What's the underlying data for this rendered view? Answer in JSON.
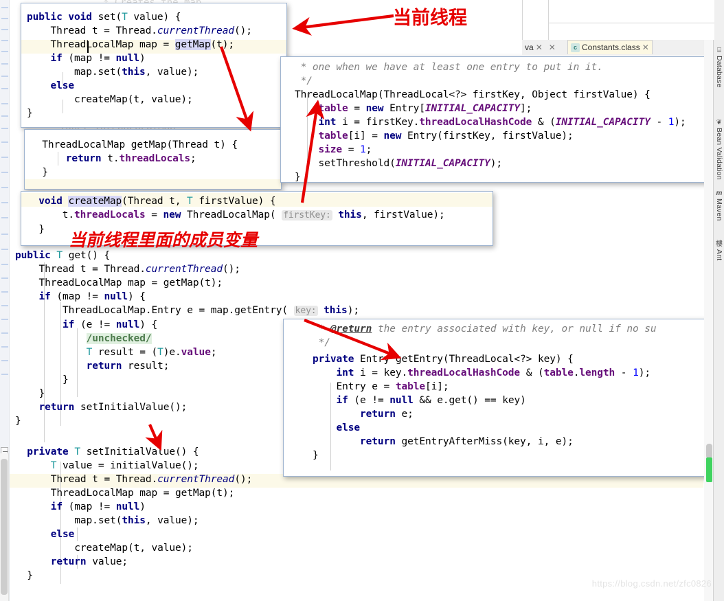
{
  "app": {
    "ide": "IntelliJ IDEA",
    "watermark": "https://blog.csdn.net/zfc0826"
  },
  "tabs": {
    "partial_label": "va",
    "close_glyph": "✕",
    "active": {
      "icon": "class-file-icon",
      "icon_letter": "c",
      "label": "Constants.class"
    }
  },
  "right_sidebar": {
    "items": [
      {
        "label": "Database",
        "icon": "database-icon",
        "glyph": "⌸"
      },
      {
        "label": "Bean Validation",
        "icon": "bean-validation-icon",
        "glyph": "❦"
      },
      {
        "label": "Maven",
        "icon": "maven-icon",
        "glyph": "m"
      },
      {
        "label": "Ant",
        "icon": "ant-icon",
        "glyph": "樓"
      }
    ]
  },
  "annotations": [
    {
      "id": "note-current-thread",
      "text": "当前线程",
      "color": "#e60000"
    },
    {
      "id": "note-member-variable",
      "text": "当前线程里面的成员变量",
      "color": "#e60000"
    }
  ],
  "background_code": {
    "line_top": "* Creates the map",
    "line_mid": "* Inner ThreadLocalMap"
  },
  "editor": {
    "name": "ThreadLocal.java",
    "lines": [
      {
        "indent": 0,
        "text": "public T get() {"
      },
      {
        "indent": 1,
        "text": "Thread t = Thread.currentThread();"
      },
      {
        "indent": 1,
        "text": "ThreadLocalMap map = getMap(t);"
      },
      {
        "indent": 1,
        "text": "if (map != null) {"
      },
      {
        "indent": 2,
        "text": "ThreadLocalMap.Entry e = map.getEntry( key: this);"
      },
      {
        "indent": 2,
        "text": "if (e != null) {"
      },
      {
        "indent": 3,
        "text": "/unchecked/"
      },
      {
        "indent": 3,
        "text": "T result = (T)e.value;"
      },
      {
        "indent": 3,
        "text": "return result;"
      },
      {
        "indent": 2,
        "text": "}"
      },
      {
        "indent": 1,
        "text": "}"
      },
      {
        "indent": 1,
        "text": "return setInitialValue();"
      },
      {
        "indent": 0,
        "text": "}"
      },
      {
        "indent": 0,
        "text": "private T setInitialValue() {"
      },
      {
        "indent": 1,
        "text": "T value = initialValue();"
      },
      {
        "indent": 1,
        "text": "Thread t = Thread.currentThread();"
      },
      {
        "indent": 1,
        "text": "ThreadLocalMap map = getMap(t);"
      },
      {
        "indent": 1,
        "text": "if (map != null)"
      },
      {
        "indent": 2,
        "text": "map.set(this, value);"
      },
      {
        "indent": 1,
        "text": "else"
      },
      {
        "indent": 2,
        "text": "createMap(t, value);"
      },
      {
        "indent": 1,
        "text": "return value;"
      },
      {
        "indent": 0,
        "text": "}"
      }
    ]
  },
  "popups": {
    "set_method": {
      "name": "ThreadLocal.set",
      "lines": [
        "public void set(T value) {",
        "    Thread t = Thread.currentThread();",
        "    ThreadLocalMap map = getMap(t);",
        "    if (map != null)",
        "        map.set(this, value);",
        "    else",
        "        createMap(t, value);",
        "}"
      ],
      "highlighted_line": "ThreadLocalMap map = getMap(t);",
      "selected_token": "getMap"
    },
    "get_map_method": {
      "name": "ThreadLocal.getMap",
      "lines": [
        "ThreadLocalMap getMap(Thread t) {",
        "    return t.threadLocals;",
        "}"
      ]
    },
    "create_map_method": {
      "name": "ThreadLocal.createMap",
      "lines": [
        "void createMap(Thread t, T firstValue) {",
        "    t.threadLocals = new ThreadLocalMap( firstKey: this, firstValue);",
        "}"
      ],
      "hint_param": "firstKey:"
    },
    "threadlocalmap_ctor": {
      "name": "ThreadLocalMap constructor",
      "doc_lines": [
        "* one when we have at least one entry to put in it.",
        "*/"
      ],
      "lines": [
        "ThreadLocalMap(ThreadLocal<?> firstKey, Object firstValue) {",
        "    table = new Entry[INITIAL_CAPACITY];",
        "    int i = firstKey.threadLocalHashCode & (INITIAL_CAPACITY - 1);",
        "    table[i] = new Entry(firstKey, firstValue);",
        "    size = 1;",
        "    setThreshold(INITIAL_CAPACITY);",
        "}"
      ]
    },
    "get_entry_method": {
      "name": "ThreadLocalMap.getEntry",
      "doc_lines": [
        "* @return the entry associated with key, or null if no su",
        "*/"
      ],
      "lines": [
        "private Entry getEntry(ThreadLocal<?> key) {",
        "    int i = key.threadLocalHashCode & (table.length - 1);",
        "    Entry e = table[i];",
        "    if (e != null && e.get() == key)",
        "        return e;",
        "    else",
        "        return getEntryAfterMiss(key, i, e);",
        "}"
      ],
      "javadoc_tag": "@return"
    }
  },
  "colors": {
    "keyword": "#000080",
    "type_param": "#20999d",
    "field": "#660e7a",
    "constant": "#660e7a",
    "number": "#0000ff",
    "comment": "#808080",
    "annotation_red": "#e60000",
    "line_highlight": "#fcf9e8",
    "selection": "#d7d7f7",
    "tab_active_bg": "#fcf8e3",
    "scroll_marker_green": "#3fd35f"
  }
}
